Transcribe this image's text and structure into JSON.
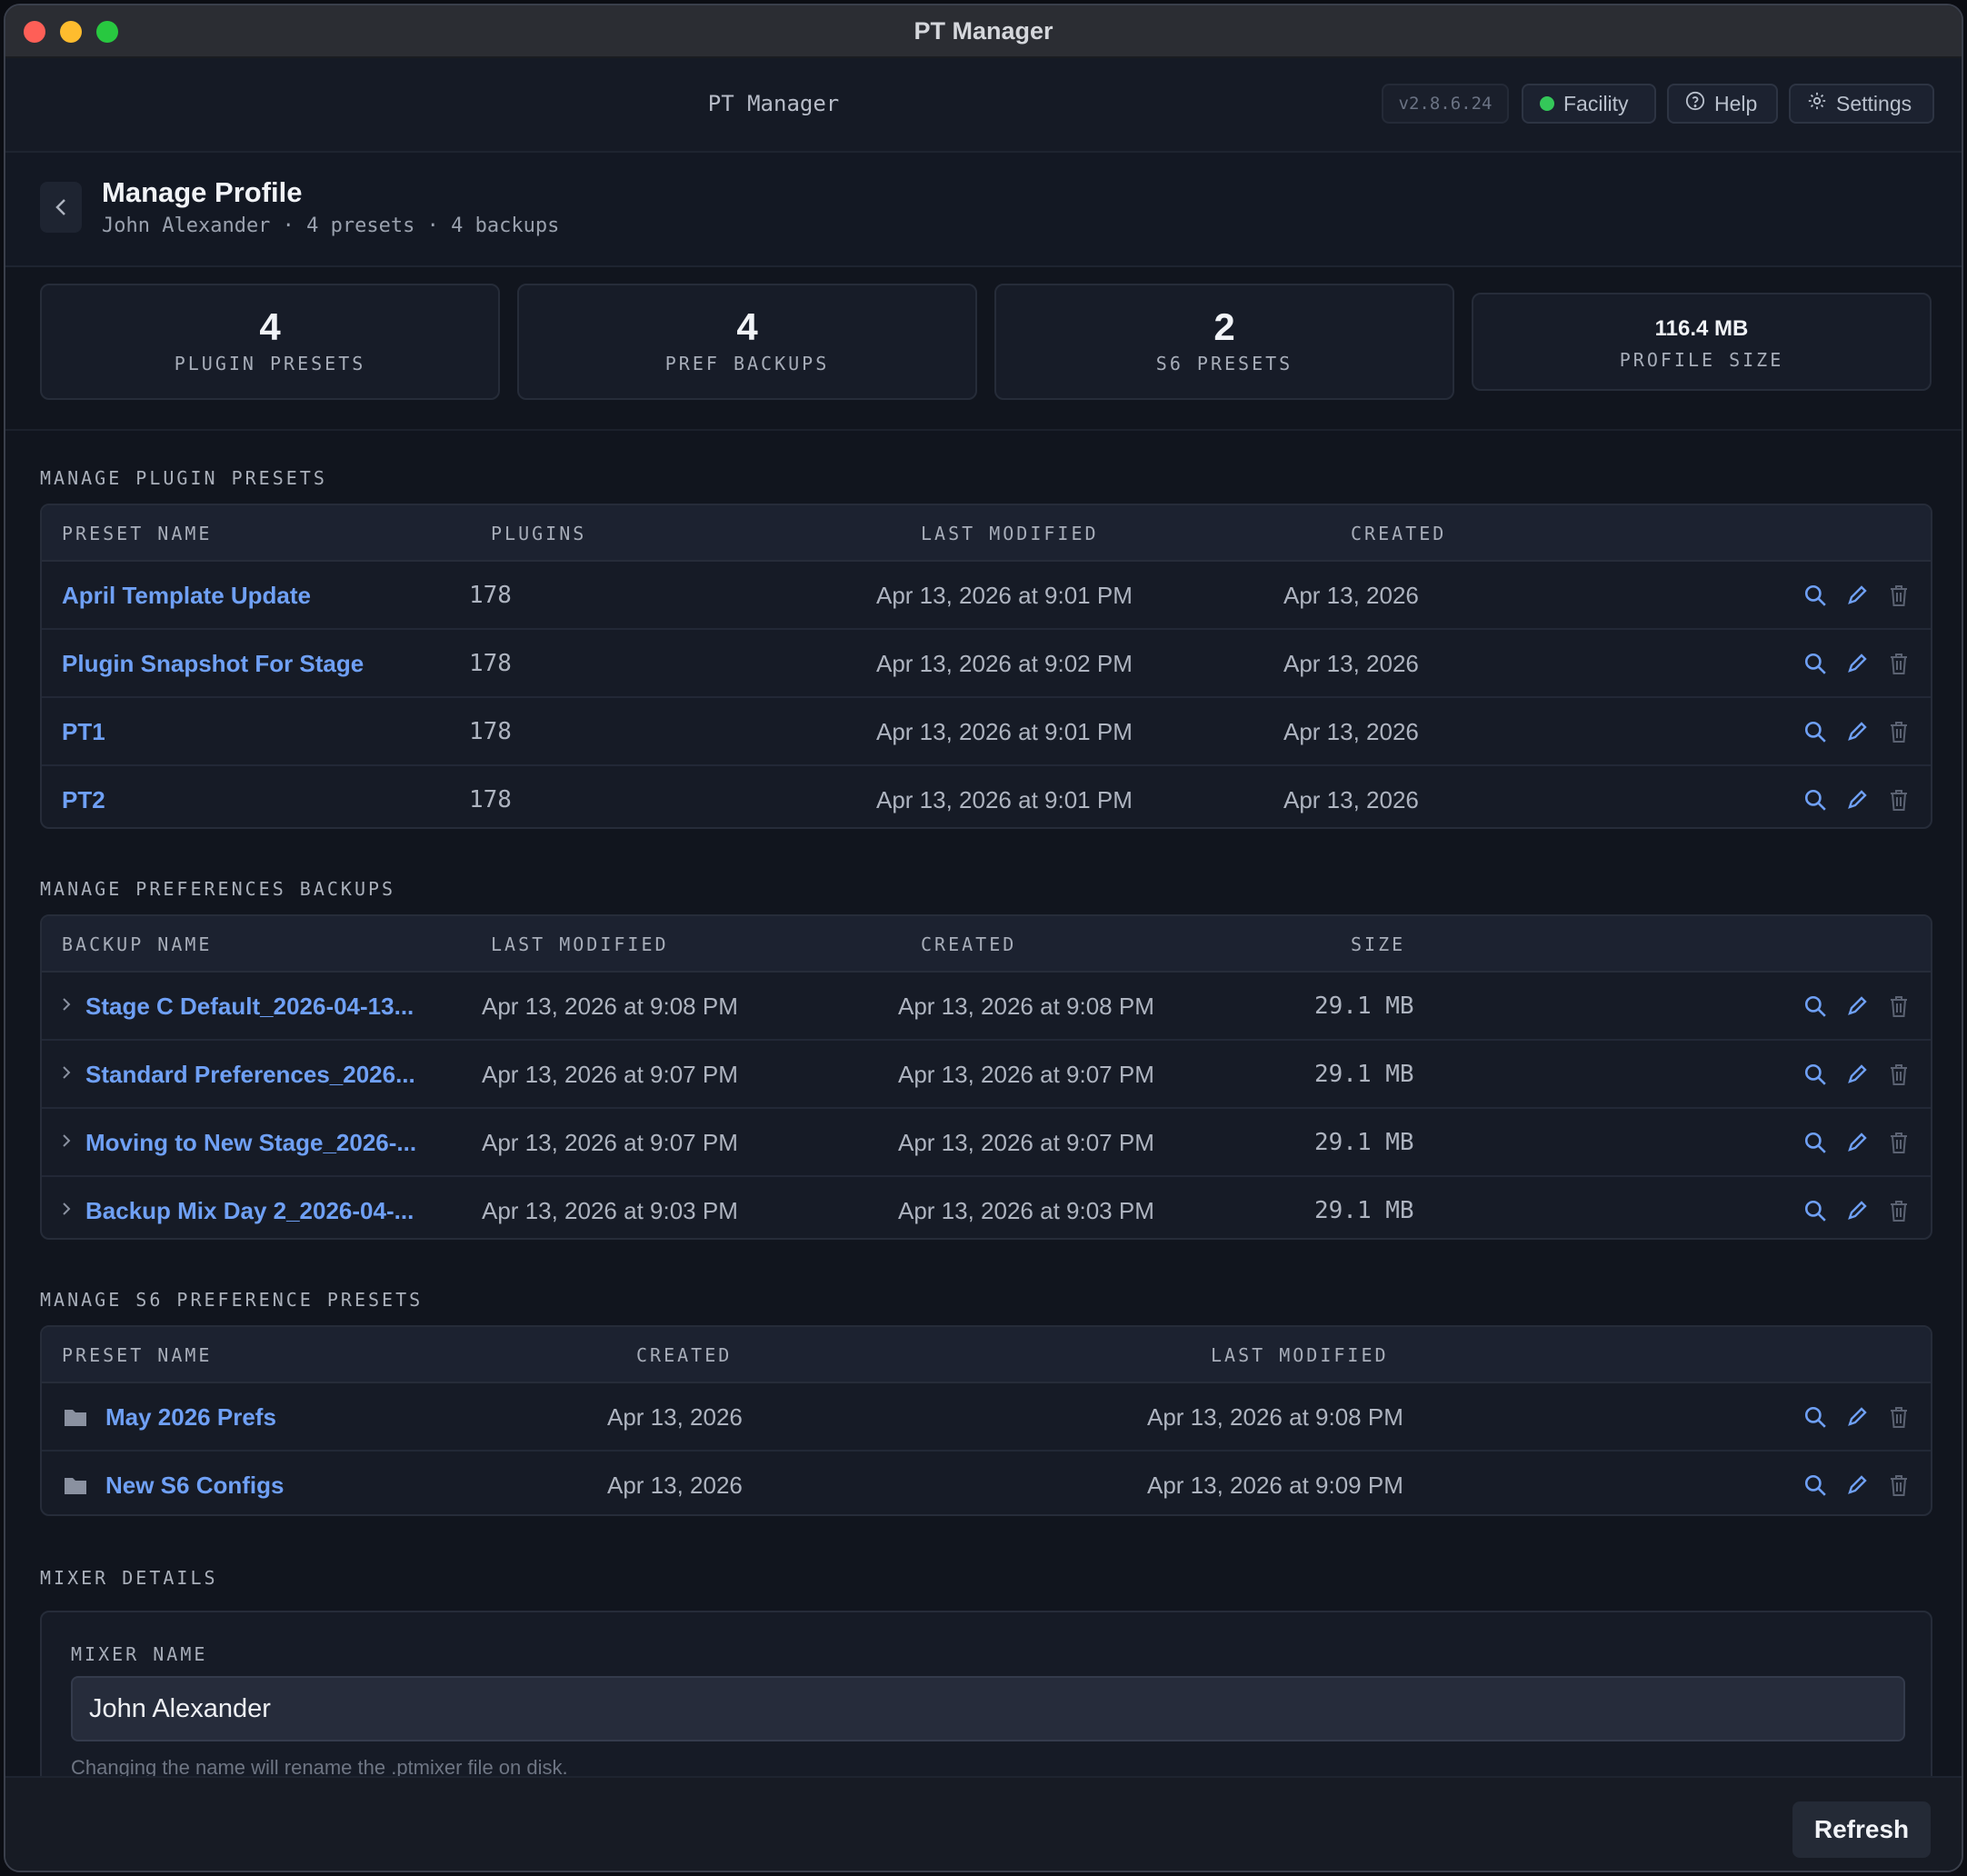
{
  "window": {
    "title": "PT Manager"
  },
  "header": {
    "app_name": "PT Manager",
    "version": "v2.8.6.24",
    "facility_label": "Facility",
    "facility_status_color": "#34c759",
    "help_label": "Help",
    "settings_label": "Settings"
  },
  "page": {
    "title": "Manage Profile",
    "subtitle": "John Alexander · 4 presets · 4 backups"
  },
  "stats": [
    {
      "value": "4",
      "label": "PLUGIN PRESETS"
    },
    {
      "value": "4",
      "label": "PREF BACKUPS"
    },
    {
      "value": "2",
      "label": "S6 PRESETS"
    },
    {
      "value": "116.4 MB",
      "label": "PROFILE SIZE"
    }
  ],
  "plugin_presets": {
    "title": "MANAGE PLUGIN PRESETS",
    "columns": [
      "PRESET NAME",
      "PLUGINS",
      "LAST MODIFIED",
      "CREATED"
    ],
    "rows": [
      {
        "name": "April Template Update",
        "plugins": "178",
        "modified": "Apr 13, 2026 at 9:01 PM",
        "created": "Apr 13, 2026"
      },
      {
        "name": "Plugin Snapshot For Stage",
        "plugins": "178",
        "modified": "Apr 13, 2026 at 9:02 PM",
        "created": "Apr 13, 2026"
      },
      {
        "name": "PT1",
        "plugins": "178",
        "modified": "Apr 13, 2026 at 9:01 PM",
        "created": "Apr 13, 2026"
      },
      {
        "name": "PT2",
        "plugins": "178",
        "modified": "Apr 13, 2026 at 9:01 PM",
        "created": "Apr 13, 2026"
      }
    ]
  },
  "pref_backups": {
    "title": "MANAGE PREFERENCES BACKUPS",
    "columns": [
      "BACKUP NAME",
      "LAST MODIFIED",
      "CREATED",
      "SIZE"
    ],
    "rows": [
      {
        "name": "Stage C Default_2026-04-13...",
        "modified": "Apr 13, 2026 at 9:08 PM",
        "created": "Apr 13, 2026 at 9:08 PM",
        "size": "29.1 MB"
      },
      {
        "name": "Standard Preferences_2026...",
        "modified": "Apr 13, 2026 at 9:07 PM",
        "created": "Apr 13, 2026 at 9:07 PM",
        "size": "29.1 MB"
      },
      {
        "name": "Moving to New Stage_2026-...",
        "modified": "Apr 13, 2026 at 9:07 PM",
        "created": "Apr 13, 2026 at 9:07 PM",
        "size": "29.1 MB"
      },
      {
        "name": "Backup Mix Day 2_2026-04-...",
        "modified": "Apr 13, 2026 at 9:03 PM",
        "created": "Apr 13, 2026 at 9:03 PM",
        "size": "29.1 MB"
      }
    ]
  },
  "s6_presets": {
    "title": "MANAGE S6 PREFERENCE PRESETS",
    "columns": [
      "PRESET NAME",
      "CREATED",
      "LAST MODIFIED"
    ],
    "rows": [
      {
        "name": "May 2026 Prefs",
        "created": "Apr 13, 2026",
        "modified": "Apr 13, 2026 at 9:08 PM"
      },
      {
        "name": "New S6 Configs",
        "created": "Apr 13, 2026",
        "modified": "Apr 13, 2026 at 9:09 PM"
      }
    ]
  },
  "mixer": {
    "title": "MIXER DETAILS",
    "field_label": "MIXER NAME",
    "name_value": "John Alexander",
    "hint": "Changing the name will rename the .ptmixer file on disk."
  },
  "footer": {
    "refresh_label": "Refresh"
  },
  "icons": {
    "row_actions": [
      "search-icon",
      "pencil-icon",
      "trash-icon"
    ],
    "accent": "#6fa0f5"
  }
}
